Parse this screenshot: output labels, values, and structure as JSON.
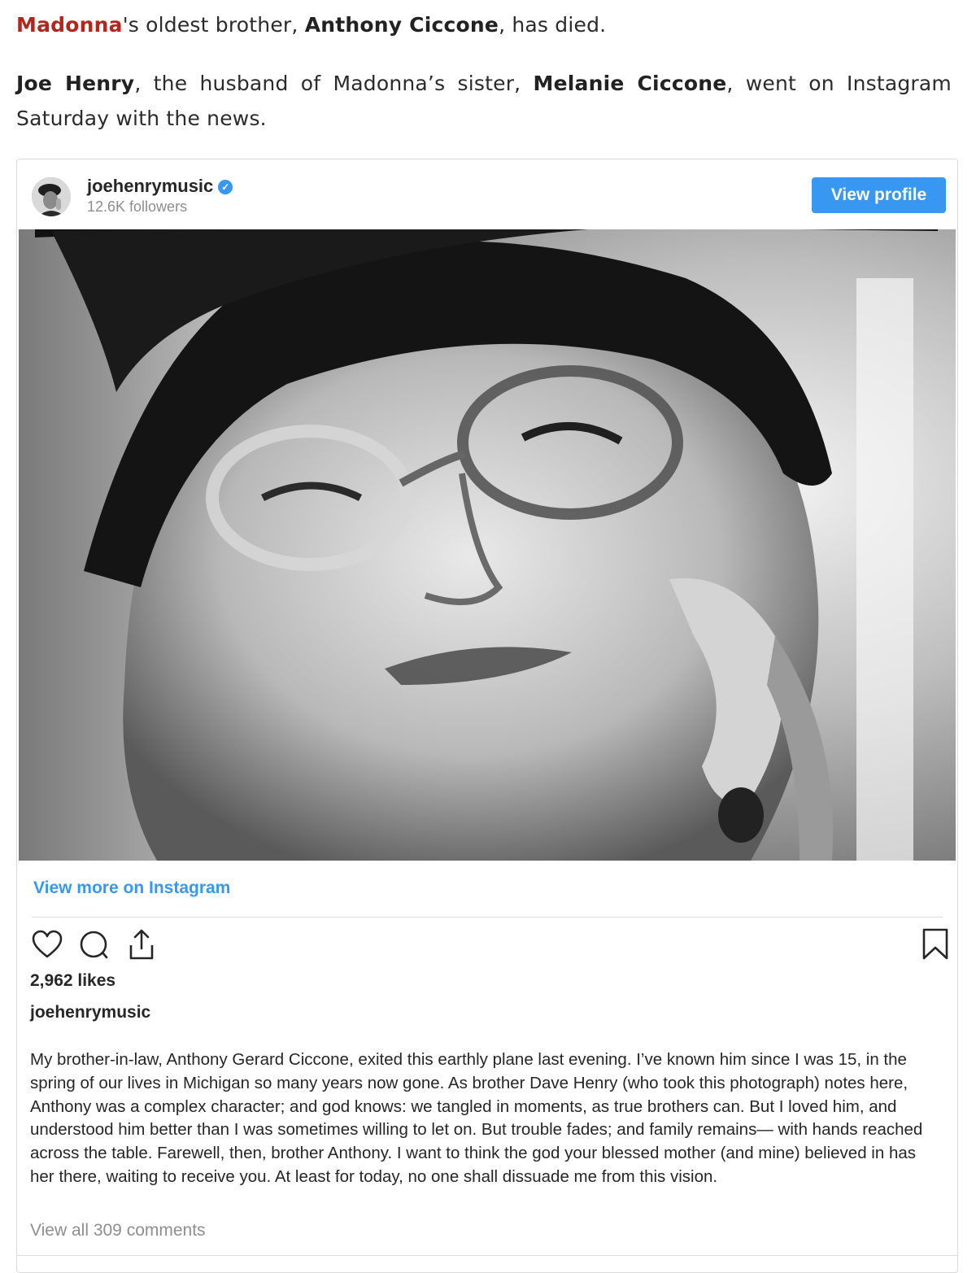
{
  "article": {
    "p1": {
      "link": "Madonna",
      "t1": "'s oldest brother, ",
      "b1": "Anthony Ciccone",
      "t2": ", has died."
    },
    "p2": {
      "b1": "Joe Henry",
      "t1": ", the husband of Madonna’s sister, ",
      "b2": "Melanie Ciccone",
      "t2": ", went on Instagram Saturday with the news."
    }
  },
  "embed": {
    "username": "joehenrymusic",
    "followers": "12.6K followers",
    "view_profile": "View profile",
    "view_more": "View more on Instagram",
    "likes": "2,962 likes",
    "caption_user": "joehenrymusic",
    "caption": "My brother-in-law, Anthony Gerard Ciccone, exited this earthly plane last evening. I’ve known him since I was 15, in the spring of our lives in Michigan so many years now gone. As brother Dave Henry (who took this photograph) notes here, Anthony was a complex character; and god knows: we tangled in moments, as true brothers can. But I loved him, and understood him better than I was sometimes willing to let on. But trouble fades; and family remains— with hands reached across the table. Farewell, then, brother Anthony. I want to think the god your blessed mother (and mine) believed in has her there, waiting to receive you. At least for today, no one shall dissuade me from this vision.",
    "comments": "View all 309 comments",
    "verified_icon": "✓",
    "accent": "#3897f0",
    "link_red": "#b3261e",
    "icons": [
      "heart-icon",
      "comment-icon",
      "share-icon",
      "bookmark-icon",
      "verified-badge-icon"
    ]
  }
}
